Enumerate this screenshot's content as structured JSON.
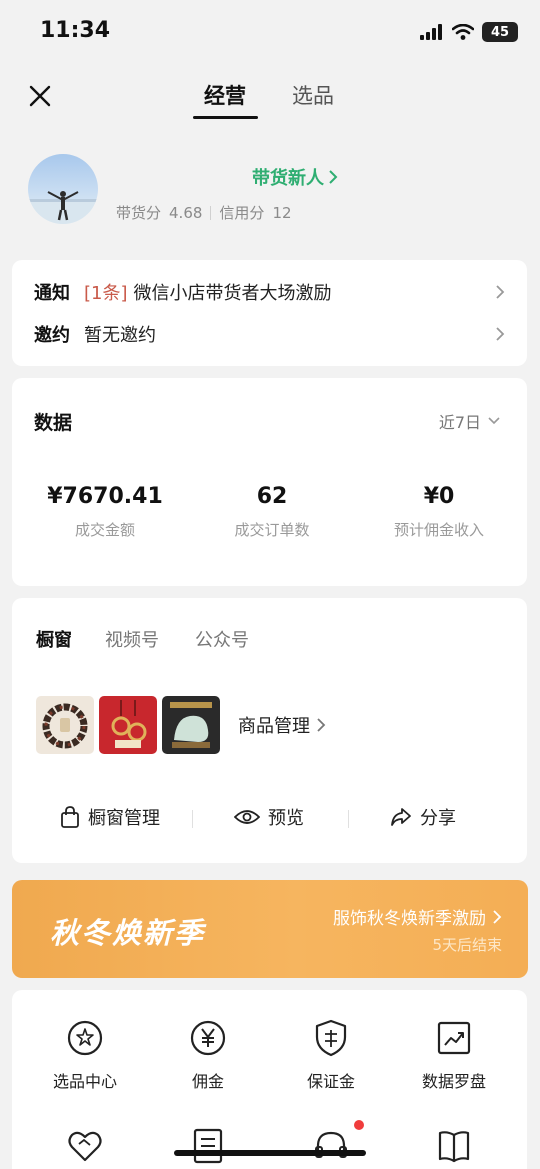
{
  "status_bar": {
    "time": "11:34",
    "battery": "45"
  },
  "nav": {
    "tabs": [
      "经营",
      "选品"
    ],
    "active_tab": "经营"
  },
  "profile": {
    "role": "带货新人",
    "sales_score_label": "带货分",
    "sales_score": "4.68",
    "credit_score_label": "信用分",
    "credit_score": "12"
  },
  "notices": [
    {
      "label": "通知",
      "tag": "[1条]",
      "text": "微信小店带货者大场激励"
    },
    {
      "label": "邀约",
      "tag": "",
      "text": "暂无邀约"
    }
  ],
  "data_panel": {
    "title": "数据",
    "range": "近7日",
    "stats": [
      {
        "value": "¥7670.41",
        "label": "成交金额"
      },
      {
        "value": "62",
        "label": "成交订单数"
      },
      {
        "value": "¥0",
        "label": "预计佣金收入"
      }
    ]
  },
  "window_panel": {
    "tabs": [
      "橱窗",
      "视频号",
      "公众号"
    ],
    "active_tab": "橱窗",
    "goods_link": "商品管理",
    "actions": [
      "橱窗管理",
      "预览",
      "分享"
    ]
  },
  "banner": {
    "title": "秋冬焕新季",
    "link": "服饰秋冬焕新季激励",
    "subtitle": "5天后结束"
  },
  "tools": [
    {
      "label": "选品中心",
      "icon": "star-hand-icon"
    },
    {
      "label": "佣金",
      "icon": "yen-circle-icon"
    },
    {
      "label": "保证金",
      "icon": "shield-icon"
    },
    {
      "label": "数据罗盘",
      "icon": "trend-chart-icon"
    },
    {
      "label": "",
      "icon": "heart-handshake-icon"
    },
    {
      "label": "",
      "icon": "document-icon"
    },
    {
      "label": "",
      "icon": "headset-icon"
    },
    {
      "label": "",
      "icon": "book-icon"
    }
  ],
  "colors": {
    "accent_green": "#2fae72",
    "banner_orange": "#f2aa52",
    "notice_red": "#c95a4a"
  }
}
